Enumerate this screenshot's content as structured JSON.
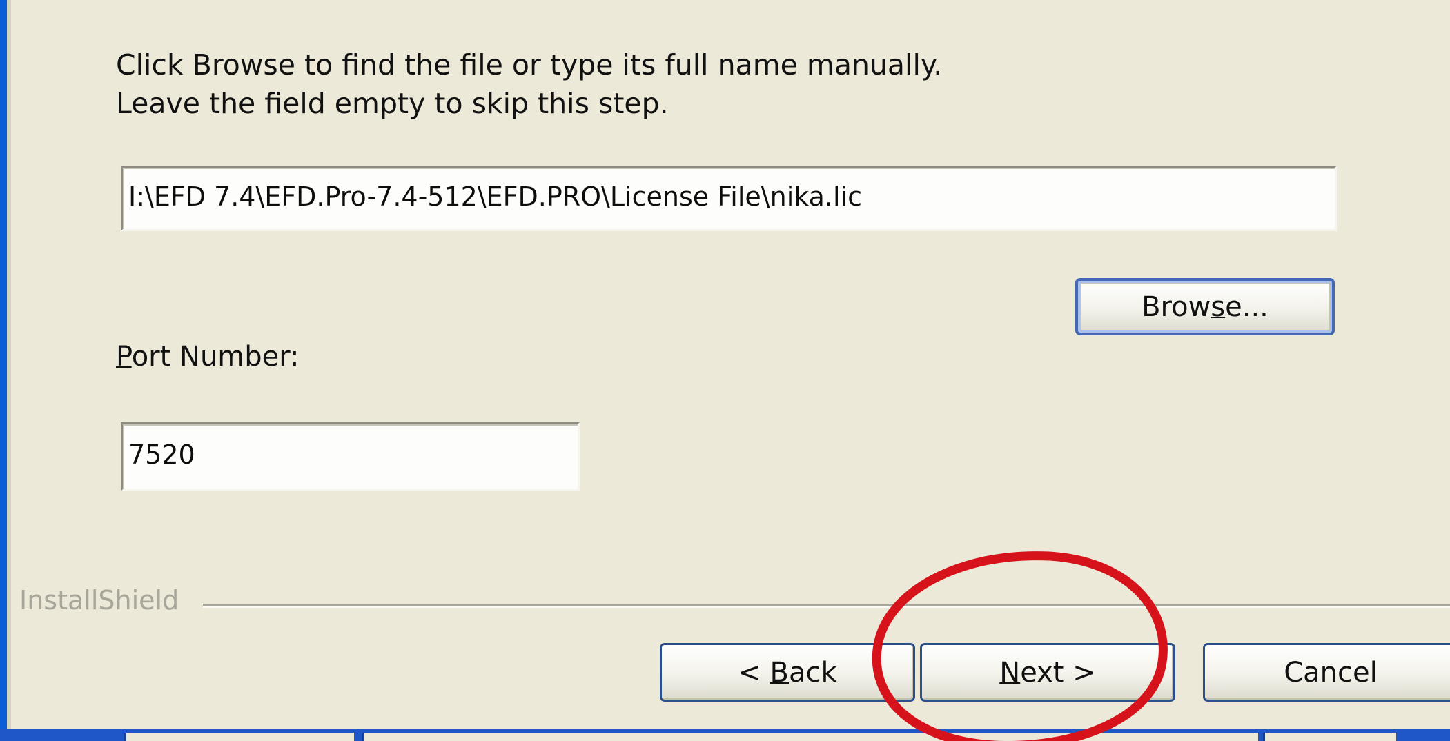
{
  "instructions": {
    "line1": "Click Browse to find the file or type its full name manually.",
    "line2": "Leave the field empty to skip this step."
  },
  "license_field": {
    "value": "I:\\EFD 7.4\\EFD.Pro-7.4-512\\EFD.PRO\\License File\\nika.lic"
  },
  "browse_button": {
    "label_before": "Brow",
    "label_mnemonic": "s",
    "label_after": "e..."
  },
  "port": {
    "label_mnemonic": "P",
    "label_rest": "ort Number:",
    "value": "7520"
  },
  "brand": {
    "text": "InstallShield"
  },
  "nav": {
    "back_prefix": "< ",
    "back_mnemonic": "B",
    "back_rest": "ack",
    "next_mnemonic": "N",
    "next_rest": "ext >",
    "cancel_label": "Cancel"
  },
  "colors": {
    "dialog_bg": "#ece9d8",
    "highlight": "#d6121b",
    "button_border": "#2b4f8a",
    "taskbar": "#1f57c8"
  }
}
